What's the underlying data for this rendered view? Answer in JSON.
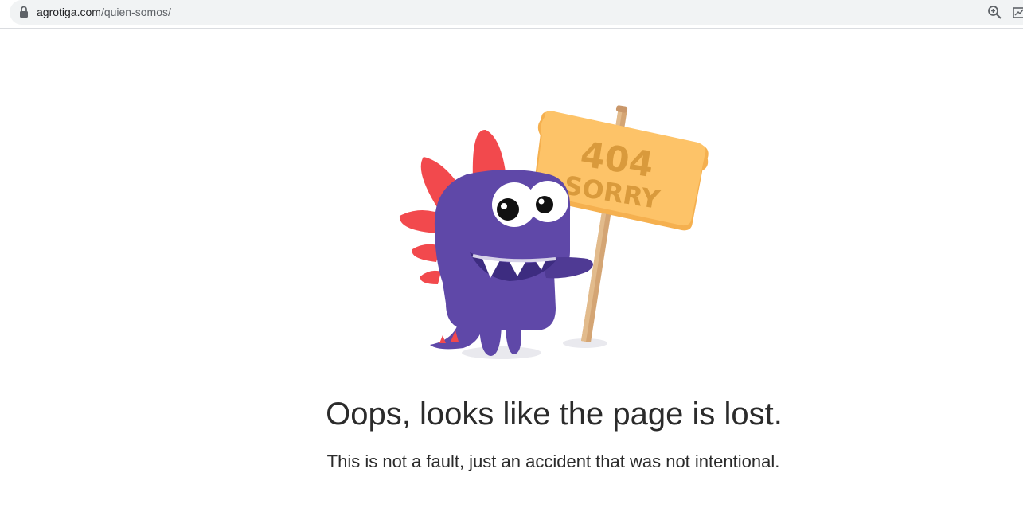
{
  "browser": {
    "url_domain": "agrotiga.com",
    "url_path": "/quien-somos/",
    "icons": {
      "lock": "lock-icon",
      "zoom": "zoom-icon",
      "edge": "open-in-app-icon"
    }
  },
  "illustration": {
    "sign_number": "404",
    "sign_word": "SORRY",
    "colors": {
      "monster": "#5f48a8",
      "spikes": "#f2494d",
      "sign": "#fdc368",
      "sign_text": "#d99a3c",
      "pole": "#d4a574"
    }
  },
  "content": {
    "heading": "Oops, looks like the page is lost.",
    "subtext": "This is not a fault, just an accident that was not intentional."
  }
}
